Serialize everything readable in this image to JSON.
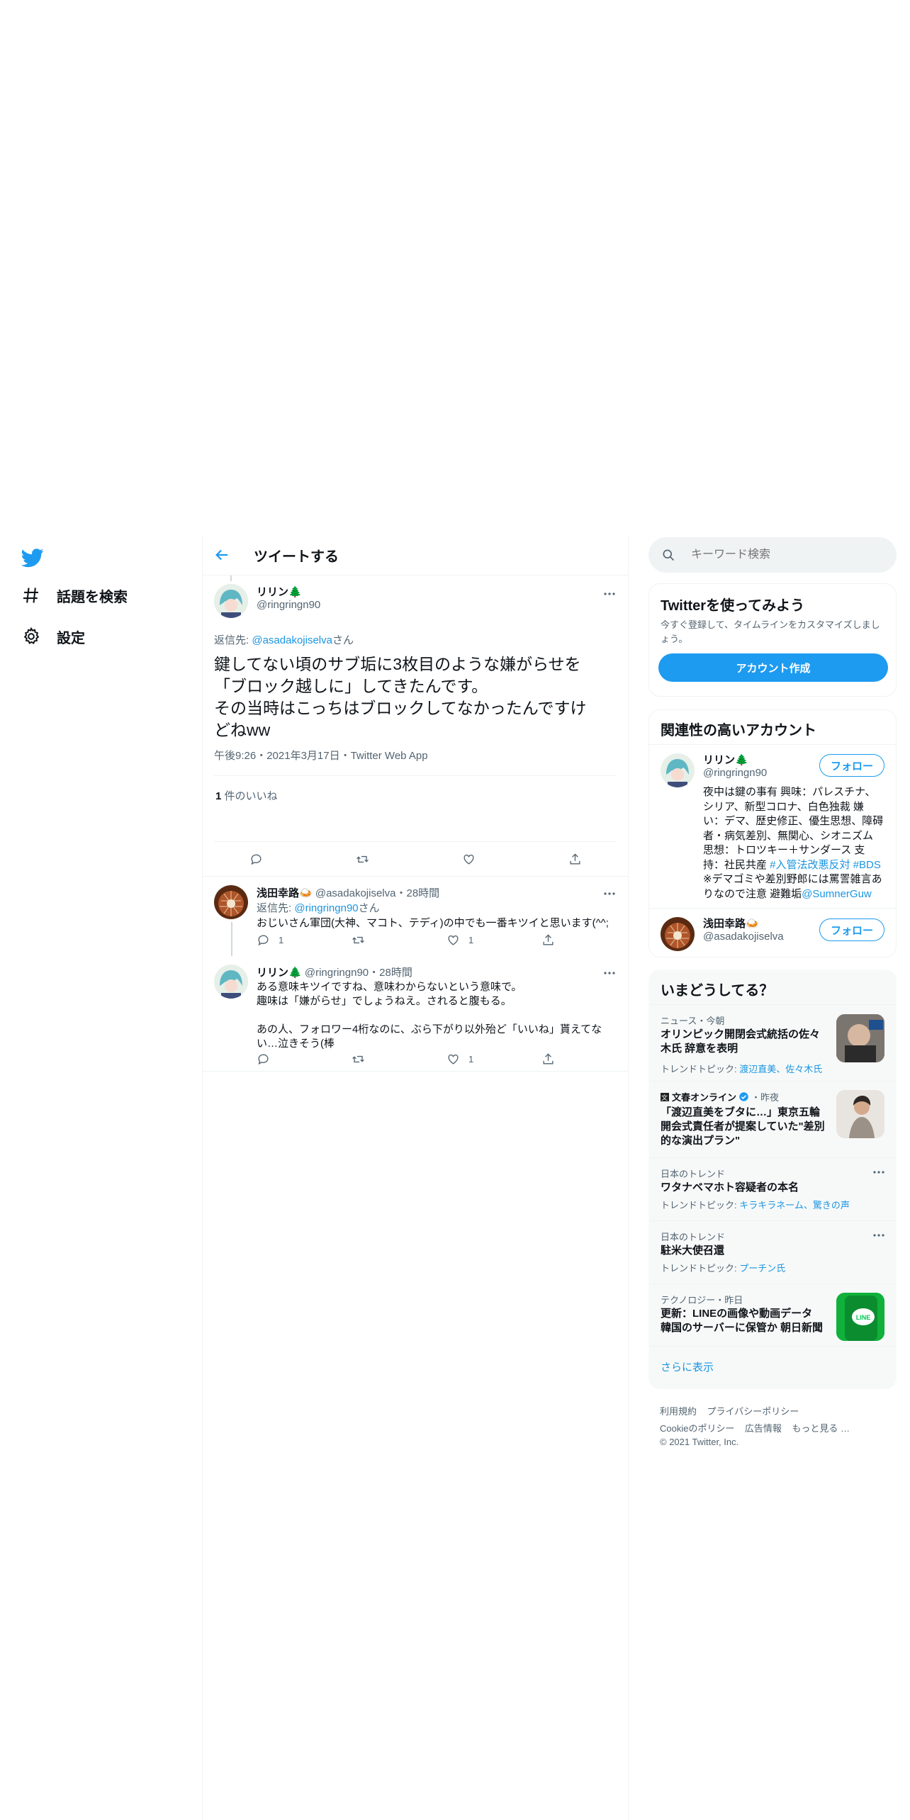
{
  "nav": {
    "items": [
      {
        "icon": "hashtag-icon",
        "label": "話題を検索"
      },
      {
        "icon": "gear-icon",
        "label": "設定"
      }
    ]
  },
  "header": {
    "title": "ツイートする"
  },
  "main_tweet": {
    "author_name": "リリン🌲",
    "handle": "@ringringn90",
    "reply_prefix": "返信先: ",
    "reply_to": "@asadakojiselva",
    "reply_suffix": "さん",
    "text_lines": [
      "鍵してない頃のサブ垢に3枚目のような嫌がらせを",
      "「ブロック越しに」してきたんです。",
      "その当時はこっちはブロックしてなかったんですけ",
      "どねww"
    ],
    "meta": "午後9:26・2021年3月17日・Twitter Web App",
    "likes_count": "1",
    "likes_label": " 件のいいね"
  },
  "replies": [
    {
      "author_name": "浅田幸路🍛",
      "handle_time": "@asadakojiselva・28時間",
      "reply_prefix": "返信先: ",
      "reply_to": "@ringringn90",
      "reply_suffix": "さん",
      "text": "おじいさん軍団(大神、マコト、テディ)の中でも一番キツイと思います(^^;",
      "reply_count": "1",
      "like_count": "1"
    },
    {
      "author_name": "リリン🌲",
      "handle_time": "@ringringn90・28時間",
      "text_lines": [
        "ある意味キツイですね、意味わからないという意味で。",
        "趣味は「嫌がらせ」でしょうねえ。されると腹もる。",
        "",
        "あの人、フォロワー4桁なのに、ぶら下がり以外殆ど「いいね」貰えてな",
        "い…泣きそう(棒"
      ],
      "like_count": "1"
    }
  ],
  "search": {
    "placeholder": "キーワード検索"
  },
  "signup": {
    "title": "Twitterを使ってみよう",
    "desc_lines": [
      "今すぐ登録して、タイムラインをカスタマイズしまし",
      "ょう。"
    ],
    "button": "アカウント作成"
  },
  "related": {
    "title": "関連性の高いアカウント",
    "follow_label": "フォロー",
    "accounts": [
      {
        "name": "リリン🌲",
        "handle": "@ringringn90",
        "bio_lines": [
          "夜中は鍵の事有 興味：パレスチナ、",
          "シリア、新型コロナ、白色独裁 嫌",
          "い：デマ、歴史修正、優生思想、障碍",
          "者・病気差別、無関心、シオニズム",
          "思想：トロツキー＋サンダース 支"
        ],
        "bio_line6_prefix": "持：社民共産 ",
        "bio_line6_link": "#入管法改悪反対 #BDS",
        "bio_line7": "※デマゴミや差別野郎には罵詈雑言あ",
        "bio_line8_prefix": "りなので注意 避難垢",
        "bio_line8_link": "@SumnerGuw"
      },
      {
        "name": "浅田幸路🍛",
        "handle": "@asadakojiselva"
      }
    ]
  },
  "trends": {
    "title": "いまどうしてる？",
    "items": [
      {
        "category": "ニュース・今朝",
        "title_lines": [
          "オリンピック開閉会式統括の佐々",
          "木氏 辞意を表明"
        ],
        "topic_prefix": "トレンドトピック: ",
        "topic_links": "渡辺直美、佐々木氏"
      },
      {
        "source": "文春オンライン",
        "time": "・昨夜",
        "title_lines": [
          "「渡辺直美をブタに…」東京五輪",
          "開会式責任者が提案していた\"差別",
          "的な演出プラン\""
        ]
      },
      {
        "category": "日本のトレンド",
        "title_lines": [
          "ワタナベマホト容疑者の本名"
        ],
        "topic_prefix": "トレンドトピック: ",
        "topic_links": "キラキラネーム、驚きの声"
      },
      {
        "category": "日本のトレンド",
        "title_lines": [
          "駐米大使召還"
        ],
        "topic_prefix": "トレンドトピック: ",
        "topic_links": "プーチン氏"
      },
      {
        "category": "テクノロジー・昨日",
        "title_lines": [
          "更新：LINEの画像や動画データ",
          "韓国のサーバーに保管か 朝日新聞"
        ],
        "thumb_text": "LINE"
      }
    ],
    "show_more": "さらに表示"
  },
  "footer": {
    "line1": [
      "利用規約",
      "プライバシーポリシー"
    ],
    "line2": [
      "Cookieのポリシー",
      "広告情報",
      "もっと見る …"
    ],
    "copyright": "© 2021 Twitter, Inc."
  },
  "colors": {
    "accent": "#1d9bf0",
    "link": "#1b95e0",
    "text": "#0f1419",
    "muted": "#536471",
    "border": "#eff3f4"
  }
}
